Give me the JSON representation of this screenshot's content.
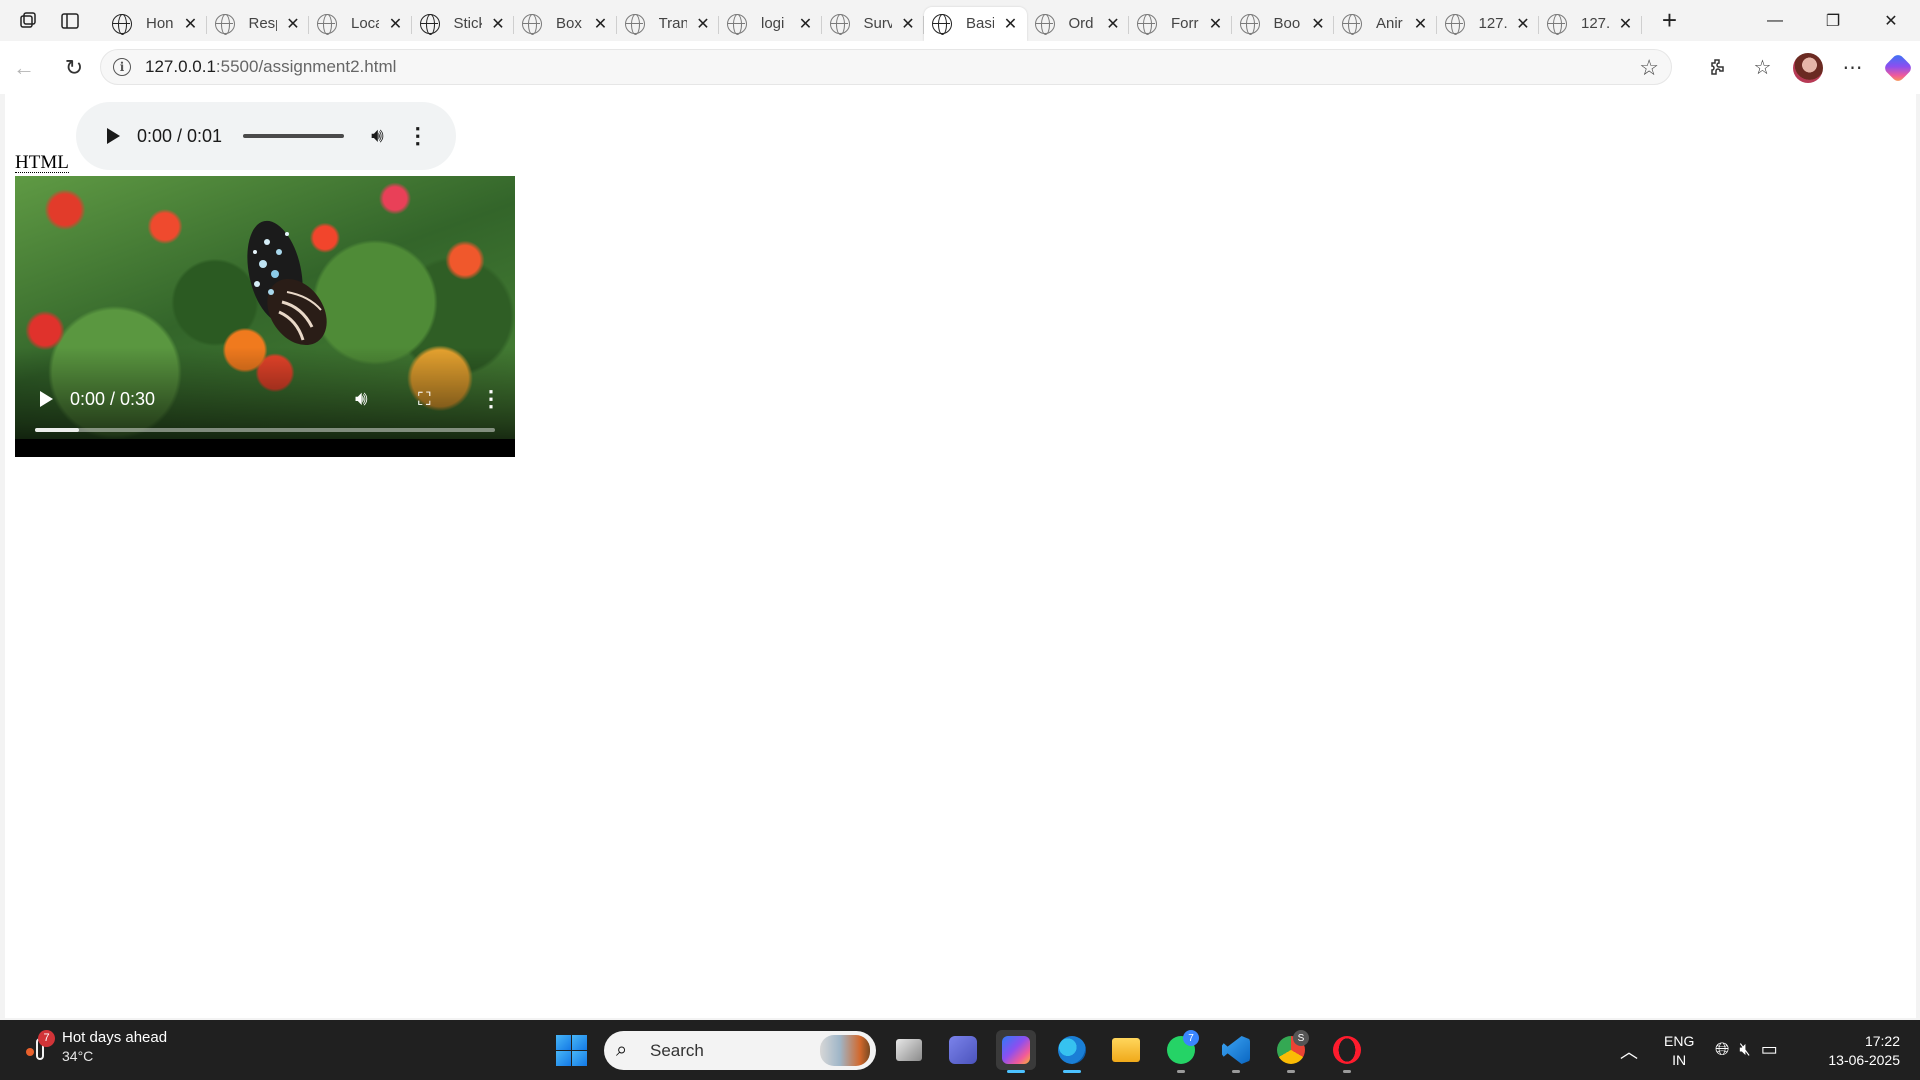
{
  "browser": {
    "tabs": [
      {
        "title": "Hon",
        "active": false
      },
      {
        "title": "Resp",
        "active": false
      },
      {
        "title": "Loca",
        "active": false
      },
      {
        "title": "Stick",
        "active": false
      },
      {
        "title": "Box",
        "active": false
      },
      {
        "title": "Tran",
        "active": false
      },
      {
        "title": "logi",
        "active": false
      },
      {
        "title": "Surv",
        "active": false
      },
      {
        "title": "Basi",
        "active": true
      },
      {
        "title": "Ord",
        "active": false
      },
      {
        "title": "Forr",
        "active": false
      },
      {
        "title": "Boo",
        "active": false
      },
      {
        "title": "Anir",
        "active": false
      },
      {
        "title": "127.",
        "active": false
      },
      {
        "title": "127.",
        "active": false
      }
    ],
    "address": {
      "host": "127.0.0.1",
      "rest": ":5500/assignment2.html"
    }
  },
  "page": {
    "audio_player": {
      "time": "0:00 / 0:01",
      "progress": 0
    },
    "heading": "HTML",
    "video_player": {
      "time": "0:00 / 0:30",
      "progress": 0
    }
  },
  "taskbar": {
    "weather": {
      "badge": "7",
      "headline": "Hot days ahead",
      "temperature": "34°C"
    },
    "search_placeholder": "Search",
    "whatsapp_badge": "7",
    "chrome_badge": "S",
    "language": {
      "line1": "ENG",
      "line2": "IN"
    },
    "clock": {
      "time": "17:22",
      "date": "13-06-2025"
    }
  },
  "colors": {
    "accent": "#4cc2ff",
    "taskbar_bg": "#202020",
    "audio_bg": "#f1f3f4"
  }
}
